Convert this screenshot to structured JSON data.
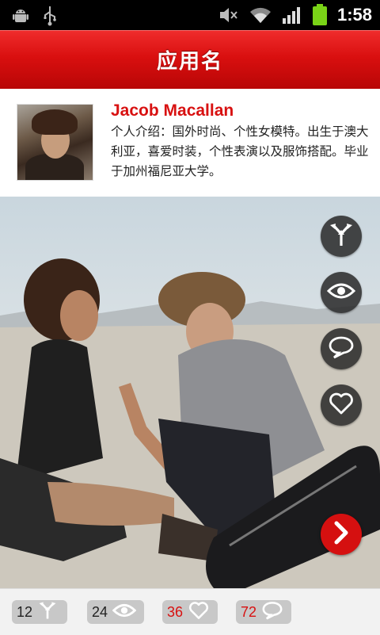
{
  "status_bar": {
    "time": "1:58",
    "icons": [
      "android-icon",
      "usb-icon",
      "mute-icon",
      "wifi-icon",
      "signal-icon",
      "battery-icon"
    ]
  },
  "header": {
    "title": "应用名"
  },
  "profile": {
    "name": "Jacob Macallan",
    "bio": "个人介绍：国外时尚、个性女模特。出生于澳大利亚，喜爱时装，个性表演以及服饰搭配。毕业于加州福尼亚大学。"
  },
  "side_actions": [
    {
      "icon": "fork-arrows-icon"
    },
    {
      "icon": "eye-icon"
    },
    {
      "icon": "comment-icon"
    },
    {
      "icon": "heart-icon"
    }
  ],
  "next_button": {
    "icon": "chevron-right-icon"
  },
  "stats": [
    {
      "count": "12",
      "icon": "fork-arrows-icon",
      "highlight": false
    },
    {
      "count": "24",
      "icon": "eye-icon",
      "highlight": false
    },
    {
      "count": "36",
      "icon": "heart-icon",
      "highlight": true
    },
    {
      "count": "72",
      "icon": "comment-icon",
      "highlight": true
    }
  ],
  "colors": {
    "accent": "#d81111",
    "title_bar": "#d90f0f",
    "status_bar": "#000000",
    "stat_pill": "#c8c8c8"
  }
}
